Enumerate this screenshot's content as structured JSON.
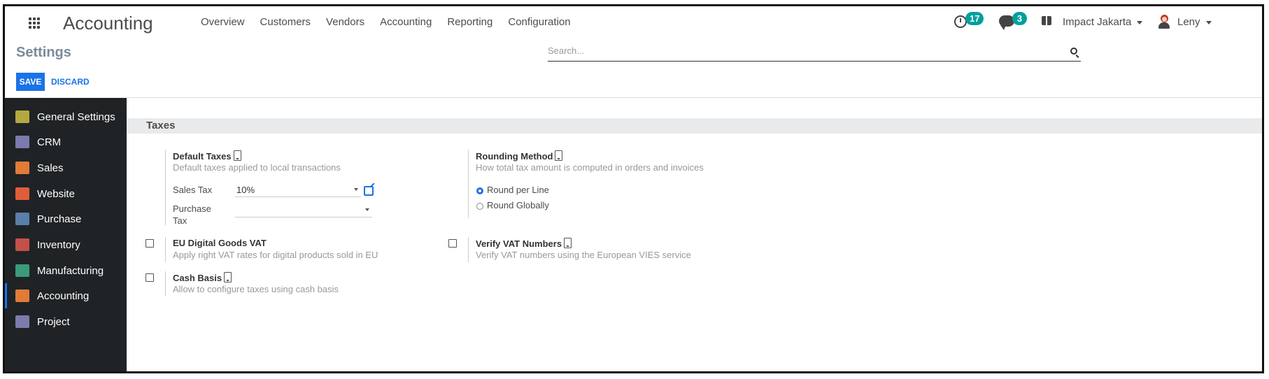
{
  "navbar": {
    "app_title": "Accounting",
    "menu": [
      "Overview",
      "Customers",
      "Vendors",
      "Accounting",
      "Reporting",
      "Configuration"
    ],
    "activity_count": "17",
    "message_count": "3",
    "company": "Impact Jakarta",
    "user": "Leny",
    "badge_color": "#00a09d"
  },
  "control_panel": {
    "title": "Settings",
    "search_placeholder": "Search...",
    "save_label": "SAVE",
    "discard_label": "DISCARD"
  },
  "sidebar": {
    "items": [
      {
        "label": "General Settings",
        "icon": "gear-icon",
        "color": "#b5a742"
      },
      {
        "label": "CRM",
        "icon": "handshake-icon",
        "color": "#7c7bad"
      },
      {
        "label": "Sales",
        "icon": "chart-icon",
        "color": "#e07b39"
      },
      {
        "label": "Website",
        "icon": "globe-icon",
        "color": "#e05d3a"
      },
      {
        "label": "Purchase",
        "icon": "card-icon",
        "color": "#5a7fa8"
      },
      {
        "label": "Inventory",
        "icon": "box-icon",
        "color": "#c4504a"
      },
      {
        "label": "Manufacturing",
        "icon": "wrench-icon",
        "color": "#3a9a7a"
      },
      {
        "label": "Accounting",
        "icon": "invoice-icon",
        "color": "#e07b39"
      },
      {
        "label": "Project",
        "icon": "puzzle-icon",
        "color": "#7c7bad"
      }
    ],
    "active": "Accounting"
  },
  "taxes": {
    "section_title": "Taxes",
    "default_taxes": {
      "title": "Default Taxes",
      "desc": "Default taxes applied to local transactions",
      "sales_tax_label": "Sales Tax",
      "sales_tax_value": "10%",
      "purchase_tax_label_1": "Purchase",
      "purchase_tax_label_2": "Tax",
      "purchase_tax_value": ""
    },
    "rounding": {
      "title": "Rounding Method",
      "desc": "How total tax amount is computed in orders and invoices",
      "options": [
        "Round per Line",
        "Round Globally"
      ],
      "selected": "Round per Line"
    },
    "eu_vat": {
      "title": "EU Digital Goods VAT",
      "desc": "Apply right VAT rates for digital products sold in EU",
      "checked": false
    },
    "verify_vat": {
      "title": "Verify VAT Numbers",
      "desc": "Verify VAT numbers using the European VIES service",
      "checked": false
    },
    "cash_basis": {
      "title": "Cash Basis",
      "desc": "Allow to configure taxes using cash basis",
      "checked": false
    }
  }
}
